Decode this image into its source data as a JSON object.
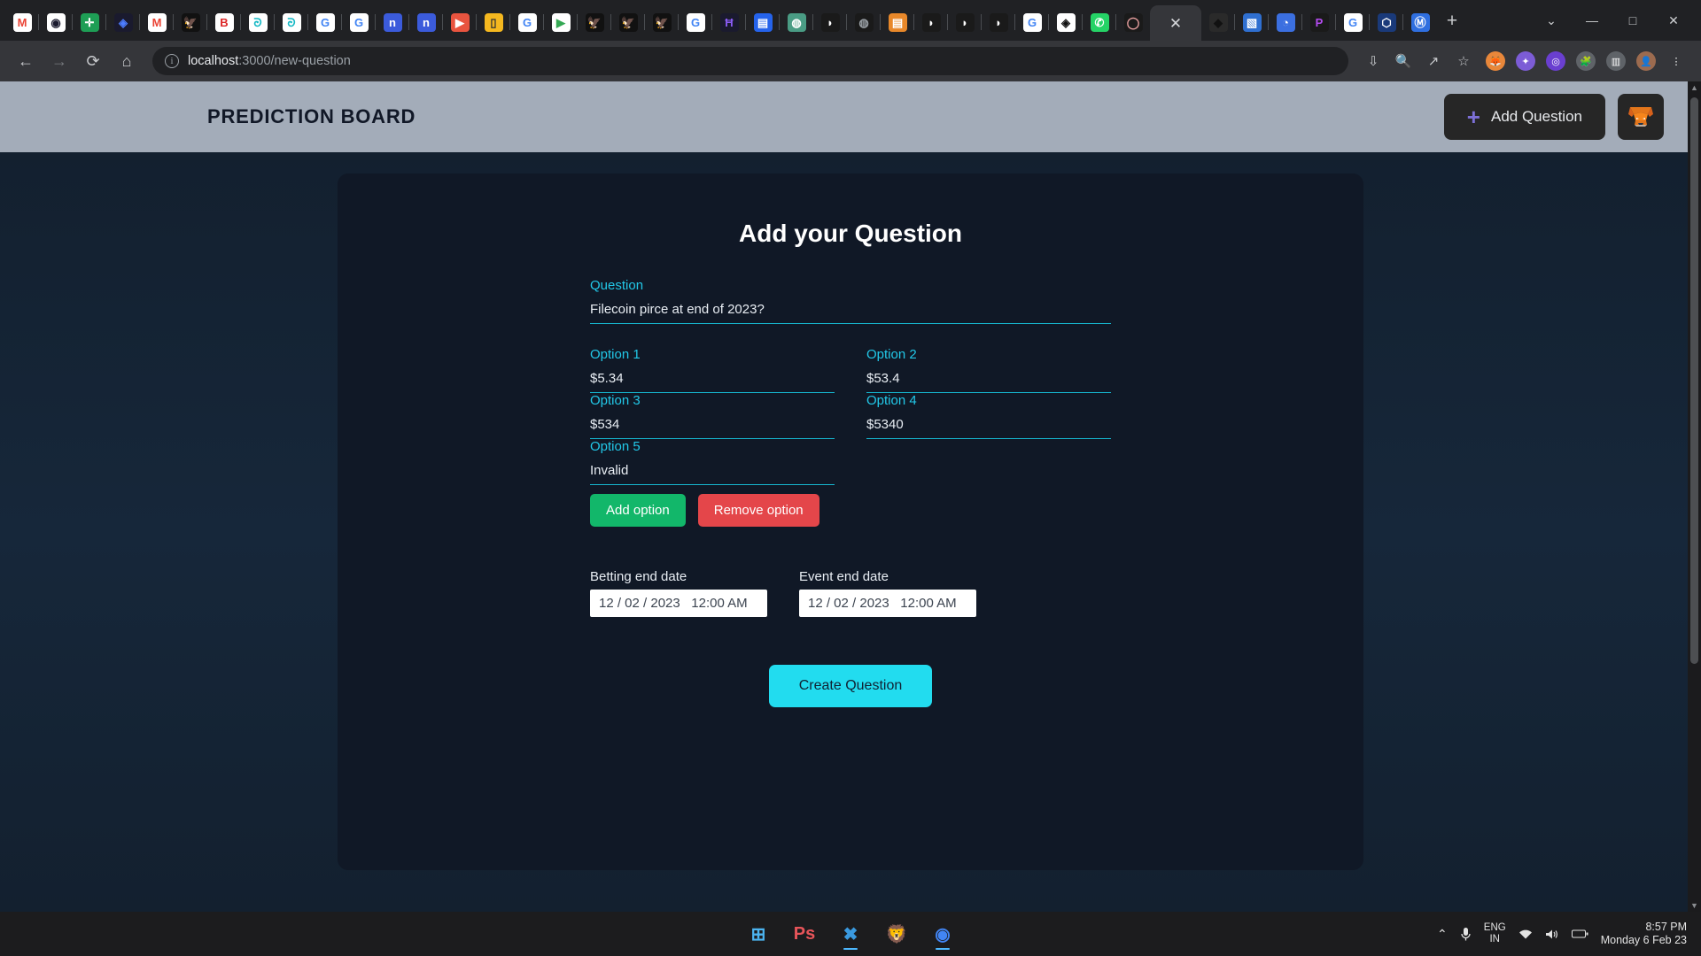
{
  "browser": {
    "tabs": [
      {
        "name": "gmail",
        "glyph": "M",
        "bg": "#ffffff",
        "fg": "#ea4335"
      },
      {
        "name": "openai-blue",
        "glyph": "◉",
        "bg": "#ffffff",
        "fg": "#1a1a2e"
      },
      {
        "name": "plus-green",
        "glyph": "✛",
        "bg": "#1e9e55",
        "fg": "#ffffff"
      },
      {
        "name": "diamond-blue",
        "glyph": "◈",
        "bg": "#1a1a2e",
        "fg": "#4d7dff"
      },
      {
        "name": "gmail-2",
        "glyph": "M",
        "bg": "#ffffff",
        "fg": "#ea4335"
      },
      {
        "name": "eagle-1",
        "glyph": "🦅",
        "bg": "#111111",
        "fg": "#ffffff"
      },
      {
        "name": "bootstrap-red",
        "glyph": "B",
        "bg": "#ffffff",
        "fg": "#dc2626"
      },
      {
        "name": "teal-knot-1",
        "glyph": "ᘒ",
        "bg": "#ffffff",
        "fg": "#14b8c4"
      },
      {
        "name": "teal-knot-2",
        "glyph": "ᘒ",
        "bg": "#ffffff",
        "fg": "#14b8c4"
      },
      {
        "name": "google-1",
        "glyph": "G",
        "bg": "#ffffff",
        "fg": "#4285f4"
      },
      {
        "name": "google-2",
        "glyph": "G",
        "bg": "#ffffff",
        "fg": "#4285f4"
      },
      {
        "name": "notion-blue-1",
        "glyph": "n",
        "bg": "#3b5bdb",
        "fg": "#ffffff"
      },
      {
        "name": "notion-blue-2",
        "glyph": "n",
        "bg": "#3b5bdb",
        "fg": "#ffffff"
      },
      {
        "name": "youtube",
        "glyph": "▶",
        "bg": "#e8543f",
        "fg": "#ffffff"
      },
      {
        "name": "yellow-note",
        "glyph": "▯",
        "bg": "#f5b81f",
        "fg": "#333333"
      },
      {
        "name": "google-3",
        "glyph": "G",
        "bg": "#ffffff",
        "fg": "#4285f4"
      },
      {
        "name": "play-store",
        "glyph": "▶",
        "bg": "#ffffff",
        "fg": "#34a853"
      },
      {
        "name": "eagle-2",
        "glyph": "🦅",
        "bg": "#111111",
        "fg": "#ffffff"
      },
      {
        "name": "eagle-3",
        "glyph": "🦅",
        "bg": "#111111",
        "fg": "#ffffff"
      },
      {
        "name": "eagle-4",
        "glyph": "🦅",
        "bg": "#111111",
        "fg": "#ffffff"
      },
      {
        "name": "google-4",
        "glyph": "G",
        "bg": "#ffffff",
        "fg": "#4285f4"
      },
      {
        "name": "hardhat-purple",
        "glyph": "Ħ",
        "bg": "#1a1a2e",
        "fg": "#8b5cf6"
      },
      {
        "name": "save-blue",
        "glyph": "▤",
        "bg": "#2563eb",
        "fg": "#ffffff"
      },
      {
        "name": "openai-green",
        "glyph": "◍",
        "bg": "#4a9c84",
        "fg": "#ffffff"
      },
      {
        "name": "github-1",
        "glyph": "◗",
        "bg": "#1a1a1a",
        "fg": "#ffffff"
      },
      {
        "name": "globe-gray",
        "glyph": "◍",
        "bg": "#1a1a1a",
        "fg": "#9aa0a6"
      },
      {
        "name": "book-orange",
        "glyph": "▤",
        "bg": "#e8882a",
        "fg": "#ffffff"
      },
      {
        "name": "github-2",
        "glyph": "◗",
        "bg": "#1a1a1a",
        "fg": "#ffffff"
      },
      {
        "name": "github-3",
        "glyph": "◗",
        "bg": "#1a1a1a",
        "fg": "#ffffff"
      },
      {
        "name": "github-4",
        "glyph": "◗",
        "bg": "#1a1a1a",
        "fg": "#ffffff"
      },
      {
        "name": "google-5",
        "glyph": "G",
        "bg": "#ffffff",
        "fg": "#4285f4"
      },
      {
        "name": "diamond-black",
        "glyph": "◈",
        "bg": "#ffffff",
        "fg": "#111111"
      },
      {
        "name": "whatsapp",
        "glyph": "✆",
        "bg": "#25d366",
        "fg": "#ffffff"
      },
      {
        "name": "record-pink",
        "glyph": "◯",
        "bg": "#1a1a1a",
        "fg": "#e8a0a0"
      }
    ],
    "tabs_after": [
      {
        "name": "gem-dark",
        "glyph": "◆",
        "bg": "#2a2a2a",
        "fg": "#111111"
      },
      {
        "name": "blue-card",
        "glyph": "▧",
        "bg": "#2f6fd0",
        "fg": "#ffffff"
      },
      {
        "name": "blue-circle",
        "glyph": "◔",
        "bg": "#3b6fe0",
        "fg": "#ffffff"
      },
      {
        "name": "purple-p",
        "glyph": "P",
        "bg": "#1a1a1a",
        "fg": "#b44cf0"
      },
      {
        "name": "google-6",
        "glyph": "G",
        "bg": "#ffffff",
        "fg": "#4285f4"
      },
      {
        "name": "hex-blue",
        "glyph": "⬡",
        "bg": "#1a3a7a",
        "fg": "#ffffff"
      },
      {
        "name": "coinmarketcap",
        "glyph": "Ⓜ",
        "bg": "#2f6fe0",
        "fg": "#ffffff"
      }
    ],
    "active_tab_close": "✕",
    "new_tab_label": "+",
    "window_controls": {
      "minimize": "—",
      "maximize": "□",
      "close": "✕",
      "chevron": "⌄"
    },
    "nav": {
      "back": "←",
      "forward": "→",
      "reload": "⟳",
      "home": "⌂"
    },
    "omnibox": {
      "info_glyph": "i",
      "url_host": "localhost",
      "url_path": ":3000/new-question"
    },
    "toolbar_icons": [
      {
        "name": "install-icon",
        "glyph": "⇩"
      },
      {
        "name": "search-icon",
        "glyph": "🔍"
      },
      {
        "name": "share-icon",
        "glyph": "↗"
      },
      {
        "name": "bookmark-star-icon",
        "glyph": "☆"
      }
    ],
    "extensions": [
      {
        "name": "metamask-extension-icon",
        "glyph": "🦊",
        "bg": "#e8873a"
      },
      {
        "name": "colorzilla-extension-icon",
        "glyph": "✦",
        "bg": "#7c5cd6"
      },
      {
        "name": "loom-extension-icon",
        "glyph": "◎",
        "bg": "#6a3fd0"
      },
      {
        "name": "puzzle-extensions-icon",
        "glyph": "🧩",
        "bg": "#5f6368"
      },
      {
        "name": "side-panel-icon",
        "glyph": "▥",
        "bg": "#5f6368"
      },
      {
        "name": "profile-avatar-icon",
        "glyph": "👤",
        "bg": "#9c6b4f"
      },
      {
        "name": "chrome-menu-icon",
        "glyph": "⋮",
        "bg": "transparent"
      }
    ]
  },
  "app": {
    "brand": "PREDICTION BOARD",
    "add_question_button": "Add Question",
    "add_question_icon": "+",
    "wallet_icon": "🦊",
    "accent_cyan": "#22c8e8",
    "header_bg": "#a3acb9"
  },
  "form": {
    "title": "Add your Question",
    "question": {
      "label": "Question",
      "value": "Filecoin pirce at end of 2023?"
    },
    "options": [
      {
        "label": "Option 1",
        "value": "$5.34"
      },
      {
        "label": "Option 2",
        "value": "$53.4"
      },
      {
        "label": "Option 3",
        "value": "$534"
      },
      {
        "label": "Option 4",
        "value": "$5340"
      },
      {
        "label": "Option 5",
        "value": "Invalid"
      }
    ],
    "add_option_button": "Add option",
    "remove_option_button": "Remove option",
    "betting_end": {
      "label": "Betting end date",
      "date": "12 / 02 / 2023",
      "time": "12:00 AM"
    },
    "event_end": {
      "label": "Event end date",
      "date": "12 / 02 / 2023",
      "time": "12:00 AM"
    },
    "submit_button": "Create Question"
  },
  "taskbar": {
    "apps": [
      {
        "name": "windows-start-icon",
        "glyph": "⊞",
        "color": "#4cb4f0",
        "running": false
      },
      {
        "name": "photoshop-icon",
        "glyph": "Ps",
        "color": "#e8555a",
        "running": false
      },
      {
        "name": "vscode-icon",
        "glyph": "✖",
        "color": "#3a9ae0",
        "running": true
      },
      {
        "name": "brave-icon",
        "glyph": "🦁",
        "color": "#f0682a",
        "running": false
      },
      {
        "name": "chrome-icon",
        "glyph": "◉",
        "color": "#4285f4",
        "running": true
      }
    ],
    "tray": {
      "chevron": "⌃",
      "mic": "🎙",
      "wifi": "📶",
      "volume": "🔊",
      "battery": "▭"
    },
    "language": {
      "line1": "ENG",
      "line2": "IN"
    },
    "clock": {
      "time": "8:57 PM",
      "date": "Monday 6 Feb 23"
    }
  }
}
